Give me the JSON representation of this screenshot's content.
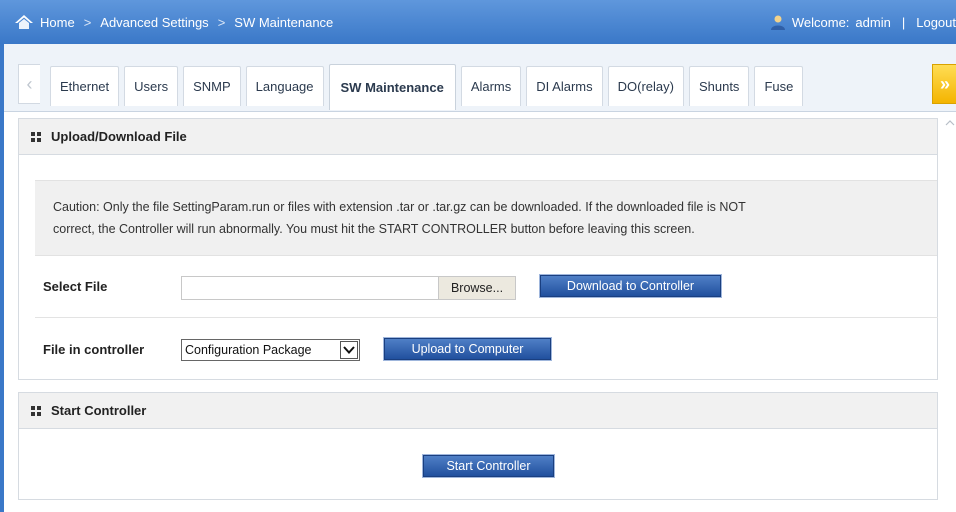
{
  "breadcrumb": {
    "items": [
      "Home",
      "Advanced Settings",
      "SW Maintenance"
    ],
    "separator": ">"
  },
  "user": {
    "welcome_label": "Welcome:",
    "username": "admin",
    "divider": "|",
    "logout_label": "Logout"
  },
  "tabs": [
    {
      "label": "Ethernet",
      "active": false
    },
    {
      "label": "Users",
      "active": false
    },
    {
      "label": "SNMP",
      "active": false
    },
    {
      "label": "Language",
      "active": false
    },
    {
      "label": "SW Maintenance",
      "active": true
    },
    {
      "label": "Alarms",
      "active": false
    },
    {
      "label": "DI Alarms",
      "active": false
    },
    {
      "label": "DO(relay)",
      "active": false
    },
    {
      "label": "Shunts",
      "active": false
    },
    {
      "label": "Fuse",
      "active": false
    }
  ],
  "tab_scroll": {
    "left_icon": "chevron-left-icon",
    "right_icon": "double-chevron-right-icon",
    "left_glyph": "‹",
    "right_glyph": "»"
  },
  "upload_panel": {
    "title": "Upload/Download File",
    "caution_line1": "Caution: Only the file SettingParam.run or files with extension .tar or .tar.gz can be downloaded. If the downloaded file is NOT",
    "caution_line2": "correct, the Controller will run abnormally. You must hit the START CONTROLLER button before leaving this screen.",
    "select_file_label": "Select File",
    "file_value": "",
    "browse_label": "Browse...",
    "download_button": "Download to Controller",
    "file_in_controller_label": "File in controller",
    "file_in_controller_selected": "Configuration Package",
    "upload_button": "Upload to Computer"
  },
  "start_panel": {
    "title": "Start Controller",
    "start_button": "Start Controller"
  },
  "colors": {
    "header_blue": "#3a78c8",
    "button_blue": "#21509e",
    "active_scroll_yellow": "#f4b400"
  }
}
